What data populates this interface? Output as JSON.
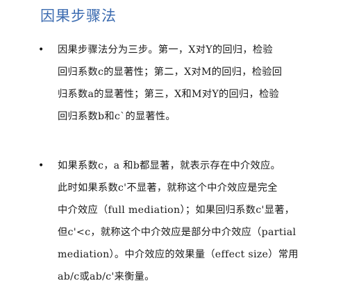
{
  "slide": {
    "title": "因果步骤法",
    "bullet_symbol": "•",
    "bullets": [
      {
        "lines": [
          "因果步骤法分为三步。第一，X对Y的回归，检验",
          "回归系数c的显著性；第二，X对M的回归，检验回",
          "归系数a的显著性；第三，X和M对Y的回归，检验",
          "回归系数b和c`的显著性。"
        ]
      },
      {
        "lines": [
          "如果系数c，a 和b都显著，就表示存在中介效应。",
          "此时如果系数c'不显著，就称这个中介效应是完全",
          "中介效应（full mediation）；如果回归系数c'显著，",
          "但c'<c，就称这个中介效应是部分中介效应（partial",
          "mediation）。中介效应的效果量（effect size）常用",
          "ab/c或ab/c'来衡量。"
        ]
      }
    ]
  }
}
